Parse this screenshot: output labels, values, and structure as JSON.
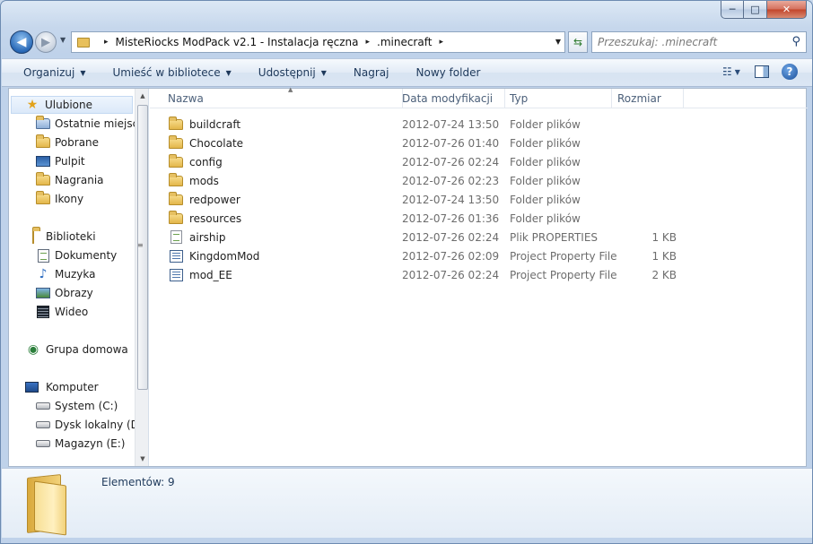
{
  "window": {
    "caption": {
      "minimize": "─",
      "maximize": "□",
      "close": "✕"
    }
  },
  "address": {
    "crumbs": [
      "MisteRiocks ModPack v2.1 - Instalacja ręczna",
      ".minecraft"
    ],
    "separator": "▸",
    "search_placeholder": "Przeszukaj: .minecraft"
  },
  "toolbar": {
    "organize": "Organizuj",
    "library": "Umieść w bibliotece",
    "share": "Udostępnij",
    "burn": "Nagraj",
    "new_folder": "Nowy folder"
  },
  "nav": {
    "favorites": {
      "label": "Ulubione",
      "items": [
        "Ostatnie miejsca",
        "Pobrane",
        "Pulpit",
        "Nagrania",
        "Ikony"
      ]
    },
    "libraries": {
      "label": "Biblioteki",
      "items": [
        "Dokumenty",
        "Muzyka",
        "Obrazy",
        "Wideo"
      ]
    },
    "homegroup": {
      "label": "Grupa domowa"
    },
    "computer": {
      "label": "Komputer",
      "items": [
        "System (C:)",
        "Dysk lokalny (D:)",
        "Magazyn (E:)"
      ]
    }
  },
  "columns": {
    "name": "Nazwa",
    "date": "Data modyfikacji",
    "type": "Typ",
    "size": "Rozmiar"
  },
  "files": [
    {
      "name": "buildcraft",
      "date": "2012-07-24 13:50",
      "type": "Folder plików",
      "size": "",
      "icon": "folder-icon"
    },
    {
      "name": "Chocolate",
      "date": "2012-07-26 01:40",
      "type": "Folder plików",
      "size": "",
      "icon": "folder-icon"
    },
    {
      "name": "config",
      "date": "2012-07-26 02:24",
      "type": "Folder plików",
      "size": "",
      "icon": "folder-icon"
    },
    {
      "name": "mods",
      "date": "2012-07-26 02:23",
      "type": "Folder plików",
      "size": "",
      "icon": "folder-icon"
    },
    {
      "name": "redpower",
      "date": "2012-07-24 13:50",
      "type": "Folder plików",
      "size": "",
      "icon": "folder-icon"
    },
    {
      "name": "resources",
      "date": "2012-07-26 01:36",
      "type": "Folder plików",
      "size": "",
      "icon": "folder-icon"
    },
    {
      "name": "airship",
      "date": "2012-07-26 02:24",
      "type": "Plik PROPERTIES",
      "size": "1 KB",
      "icon": "file-icon"
    },
    {
      "name": "KingdomMod",
      "date": "2012-07-26 02:09",
      "type": "Project Property File",
      "size": "1 KB",
      "icon": "property-file-icon"
    },
    {
      "name": "mod_EE",
      "date": "2012-07-26 02:24",
      "type": "Project Property File",
      "size": "2 KB",
      "icon": "property-file-icon"
    }
  ],
  "details": {
    "count_text": "Elementów: 9"
  }
}
